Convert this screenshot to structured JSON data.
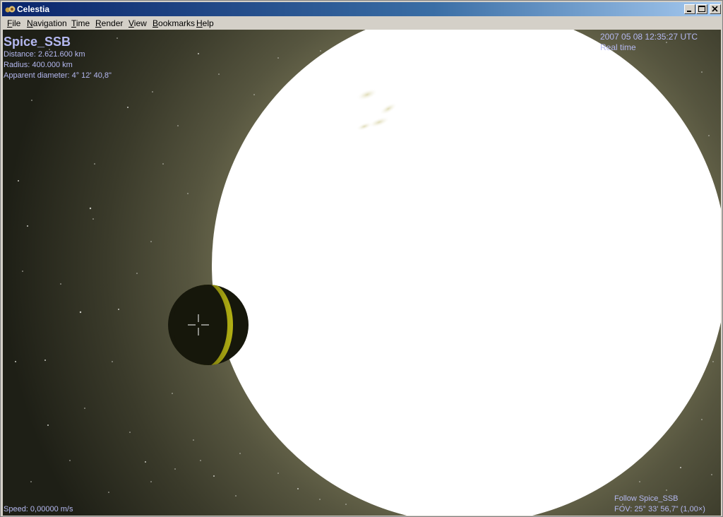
{
  "window": {
    "title": "Celestia"
  },
  "menu": [
    {
      "accel": "F",
      "rest": "ile"
    },
    {
      "accel": "N",
      "rest": "avigation"
    },
    {
      "accel": "T",
      "rest": "ime"
    },
    {
      "accel": "R",
      "rest": "ender"
    },
    {
      "accel": "V",
      "rest": "iew"
    },
    {
      "accel": "B",
      "rest": "ookmarks"
    },
    {
      "accel": "H",
      "rest": "elp"
    }
  ],
  "hud": {
    "object_name": "Spice_SSB",
    "distance": "Distance: 2.621.600 km",
    "radius": "Radius: 400.000 km",
    "apparent_diameter": "Apparent diameter: 4° 12' 40,8\"",
    "datetime": "2007 05 08 12:35:27 UTC",
    "time_rate": "Real time",
    "speed": "Speed: 0,00000 m/s",
    "follow": "Follow Spice_SSB",
    "fov": "FOV: 25° 33' 56,7\" (1,00×)"
  },
  "colors": {
    "hud_text": "#b4b8f0",
    "sun": "#ffffff",
    "space_glow": "#54533d",
    "planet_dark": "#15160a",
    "planet_lit": "#aaa810"
  },
  "icons": {
    "app": "celestia-logo-icon",
    "minimize": "minimize-icon",
    "maximize": "maximize-icon",
    "close": "close-icon",
    "crosshair": "crosshair-icon"
  }
}
